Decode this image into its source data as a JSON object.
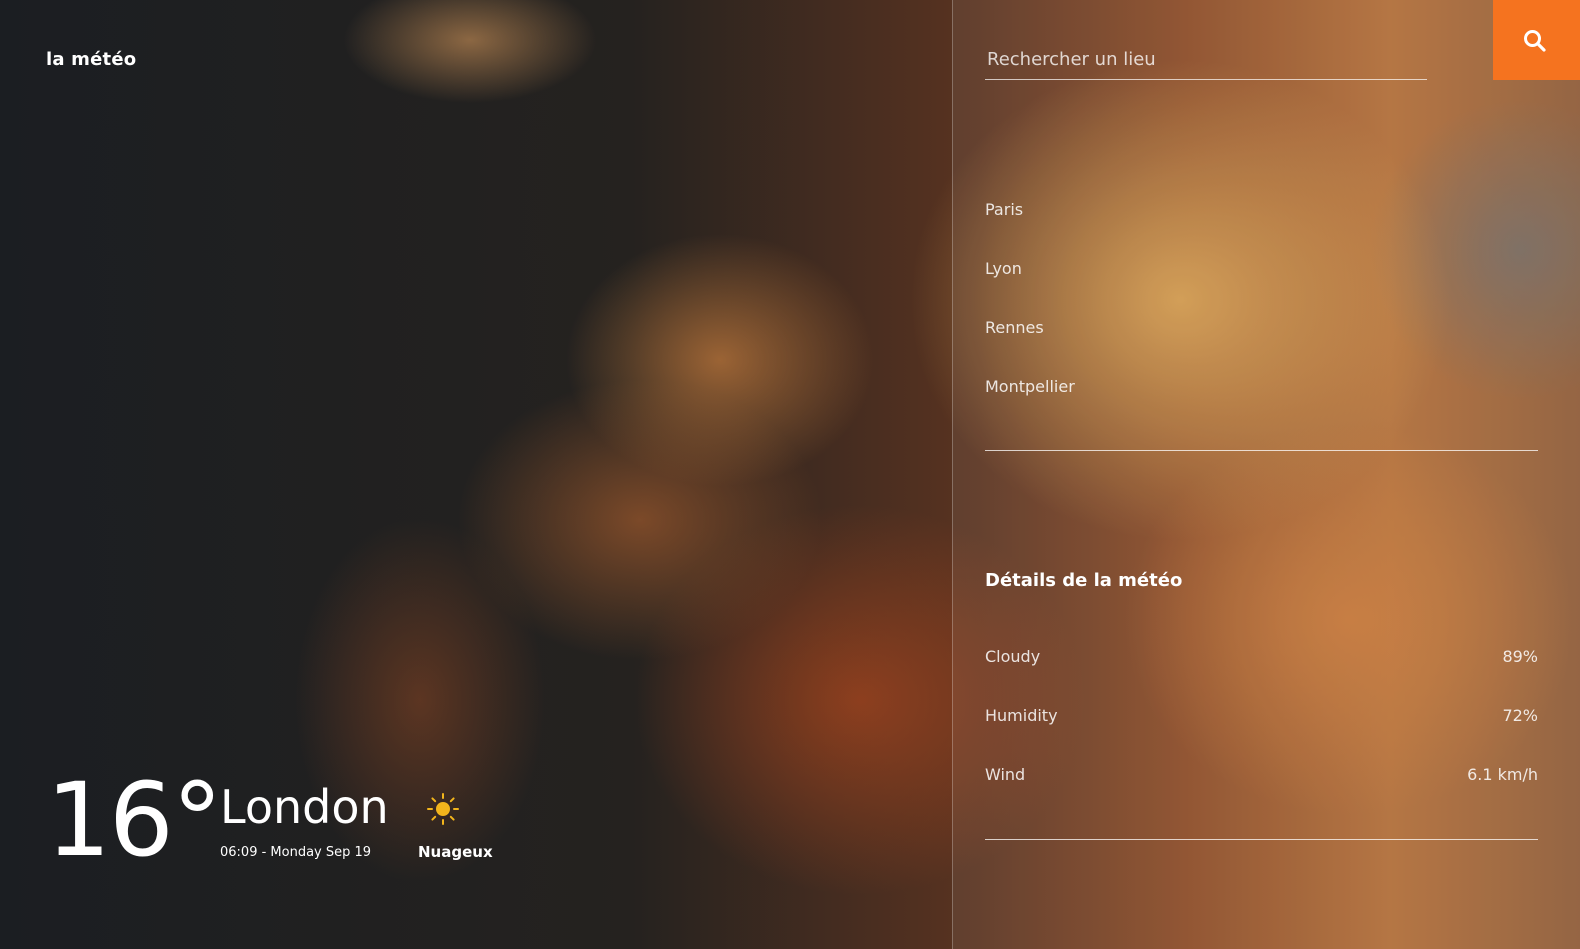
{
  "brand": "la météo",
  "current": {
    "temperature": "16°",
    "city": "London",
    "datetime": "06:09 - Monday Sep 19",
    "condition_icon": "sun-icon",
    "condition": "Nuageux"
  },
  "search": {
    "placeholder": "Rechercher un lieu",
    "value": "",
    "button_icon": "search-icon",
    "button_color": "#f5731f"
  },
  "cities": [
    "Paris",
    "Lyon",
    "Rennes",
    "Montpellier"
  ],
  "details": {
    "title": "Détails de la météo",
    "rows": [
      {
        "label": "Cloudy",
        "value": "89%"
      },
      {
        "label": "Humidity",
        "value": "72%"
      },
      {
        "label": "Wind",
        "value": "6.1 km/h"
      }
    ]
  }
}
